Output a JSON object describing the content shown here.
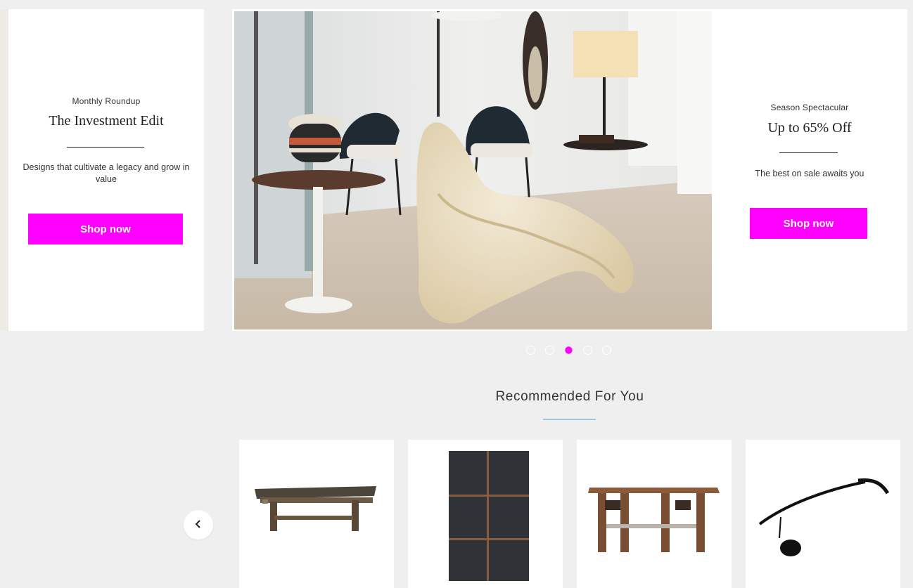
{
  "promos": {
    "left": {
      "eyebrow": "Monthly Roundup",
      "title": "The Investment Edit",
      "description": "Designs that cultivate a legacy and grow in value",
      "cta": "Shop now"
    },
    "right": {
      "eyebrow": "Season Spectacular",
      "title": "Up to 65% Off",
      "description": "The best on sale awaits you",
      "cta": "Shop now"
    }
  },
  "carousel": {
    "slide_count": 5,
    "active_slide": 3
  },
  "recommended": {
    "title": "Recommended For You",
    "items": [
      {
        "image": "rustic-workbench"
      },
      {
        "image": "dark-wood-panel-artwork"
      },
      {
        "image": "adjustable-wooden-table"
      },
      {
        "image": "black-arc-floor-lamp"
      }
    ]
  },
  "colors": {
    "accent": "#ff00ff",
    "rule": "#9ec7dd",
    "background": "#efefef"
  },
  "icons": {
    "prev": "chevron-left-icon"
  }
}
